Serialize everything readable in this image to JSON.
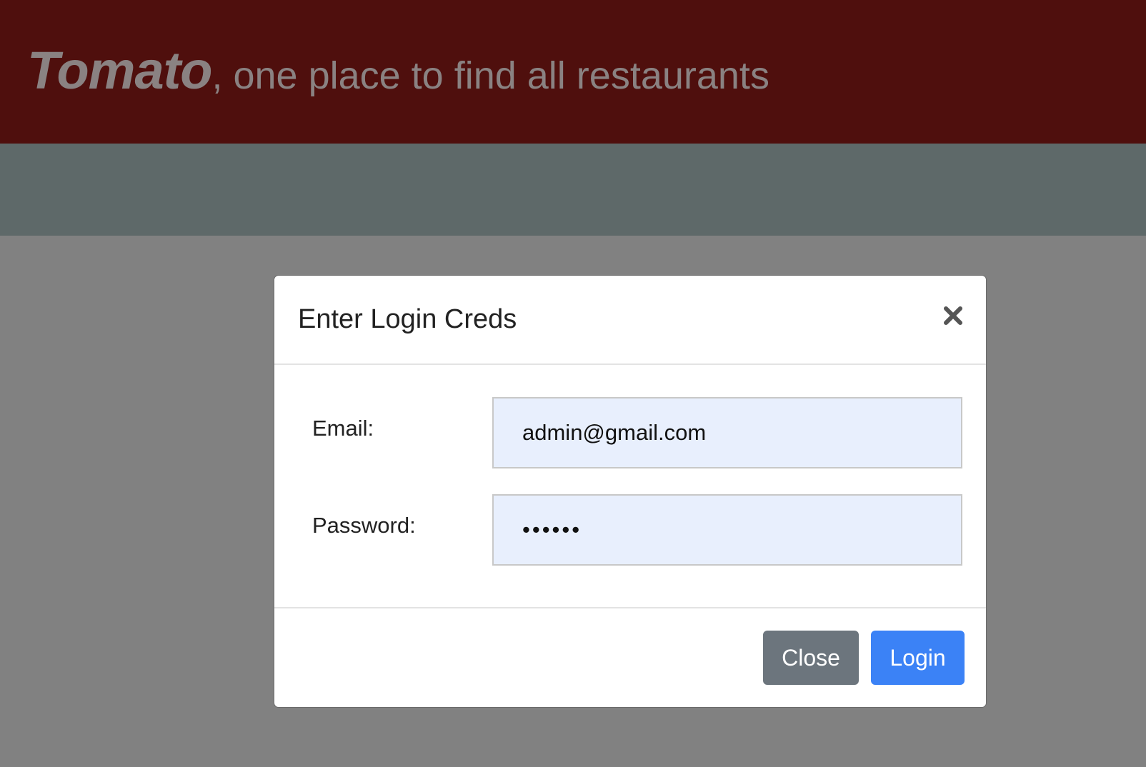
{
  "header": {
    "brand": "Tomato",
    "tagline": ", one place to find all restaurants"
  },
  "modal": {
    "title": "Enter Login Creds",
    "close_icon": "close-icon",
    "fields": {
      "email": {
        "label": "Email:",
        "value": "admin@gmail.com"
      },
      "password": {
        "label": "Password:",
        "value": "••••••"
      }
    },
    "buttons": {
      "close_label": "Close",
      "login_label": "Login"
    }
  },
  "colors": {
    "header_bg": "#4f0f0d",
    "subbar_bg": "#5e6969",
    "overlay_bg": "#818181",
    "input_bg": "#e8effd",
    "close_button": "#6c757d",
    "login_button": "#3b82f6"
  }
}
